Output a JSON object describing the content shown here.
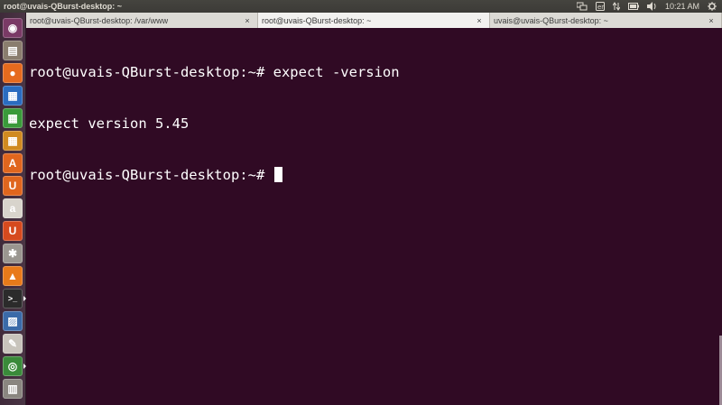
{
  "top_panel": {
    "window_title": "root@uvais-QBurst-desktop: ~",
    "clock": "10:21 AM"
  },
  "tray_icons": [
    "network-icon",
    "keyboard-icon",
    "arrows-icon",
    "battery-icon",
    "volume-icon",
    "clock",
    "gear-icon"
  ],
  "launcher": {
    "items": [
      {
        "name": "dash-icon",
        "glyph": "◉",
        "color": "#7a3a66",
        "running": false
      },
      {
        "name": "files-icon",
        "glyph": "▤",
        "color": "#8a7d6e",
        "running": false
      },
      {
        "name": "firefox-icon",
        "glyph": "●",
        "color": "#e66a1e",
        "running": false
      },
      {
        "name": "writer-icon",
        "glyph": "▦",
        "color": "#2a6cc0",
        "running": false
      },
      {
        "name": "calc-icon",
        "glyph": "▦",
        "color": "#3a9a3a",
        "running": false
      },
      {
        "name": "impress-icon",
        "glyph": "▦",
        "color": "#d08a20",
        "running": false
      },
      {
        "name": "software-center-icon",
        "glyph": "A",
        "color": "#e0661e",
        "running": false
      },
      {
        "name": "ubuntu-one-icon",
        "glyph": "U",
        "color": "#e0661e",
        "running": false
      },
      {
        "name": "amazon-icon",
        "glyph": "a",
        "color": "#d8d4cc",
        "running": false
      },
      {
        "name": "ubuntu-one-music-icon",
        "glyph": "U",
        "color": "#d64a1e",
        "running": false
      },
      {
        "name": "settings-icon",
        "glyph": "✱",
        "color": "#9a9690",
        "running": false
      },
      {
        "name": "vlc-icon",
        "glyph": "▲",
        "color": "#e87a1a",
        "running": false
      },
      {
        "name": "terminal-icon",
        "glyph": ">_",
        "color": "#2b2b2b",
        "running": true
      },
      {
        "name": "system-monitor-icon",
        "glyph": "▨",
        "color": "#3a6aa8",
        "running": false
      },
      {
        "name": "text-editor-icon",
        "glyph": "✎",
        "color": "#c8c4bc",
        "running": false
      },
      {
        "name": "chrome-icon",
        "glyph": "◎",
        "color": "#3a8a3a",
        "running": true
      },
      {
        "name": "trash-icon",
        "glyph": "▥",
        "color": "#8a8680",
        "running": false
      }
    ]
  },
  "tabs": [
    {
      "label": "root@uvais-QBurst-desktop: /var/www",
      "close": "×",
      "active": false
    },
    {
      "label": "root@uvais-QBurst-desktop: ~",
      "close": "×",
      "active": true
    },
    {
      "label": "uvais@uvais-QBurst-desktop: ~",
      "close": "×",
      "active": false
    }
  ],
  "terminal": {
    "lines": [
      "root@uvais-QBurst-desktop:~# expect -version",
      "expect version 5.45",
      "root@uvais-QBurst-desktop:~# "
    ]
  },
  "colors": {
    "terminal_bg": "#300a24",
    "panel_bg": "#3c3b37",
    "text": "#ffffff"
  }
}
